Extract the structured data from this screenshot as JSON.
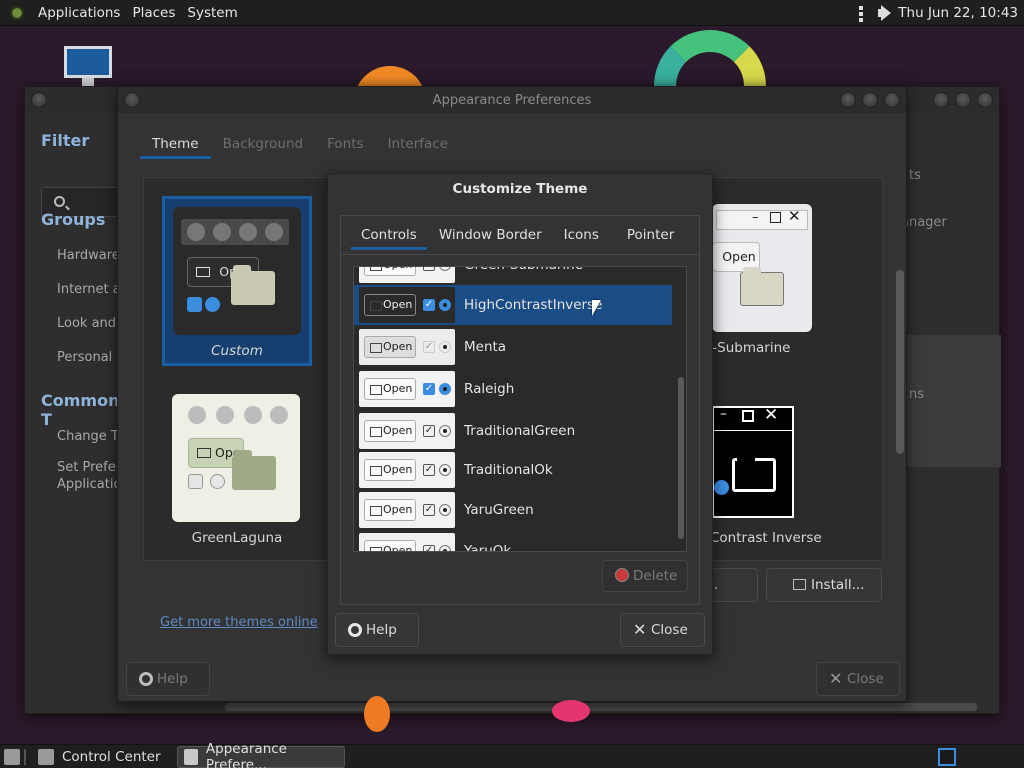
{
  "top_panel": {
    "applications": "Applications",
    "places": "Places",
    "system": "System",
    "clock": "Thu Jun 22, 10:43",
    "tray_icons": [
      "menu-dots-icon",
      "speaker-icon"
    ]
  },
  "control_center": {
    "filter_heading": "Filter",
    "groups_heading": "Groups",
    "groups": [
      "Hardware",
      "Internet a",
      "Look and",
      "Personal"
    ],
    "common_heading": "Common T",
    "common_items": [
      "Change Th",
      "Set Prefer",
      "Applicatio"
    ],
    "right_labels": [
      "ts",
      "anager",
      "ns"
    ]
  },
  "appearance": {
    "title": "Appearance Preferences",
    "tabs": [
      "Theme",
      "Background",
      "Fonts",
      "Interface"
    ],
    "active_tab": "Theme",
    "themes": {
      "custom": "Custom",
      "greenlaguna": "GreenLaguna",
      "submarine": "e-Submarine",
      "hci": "Contrast Inverse"
    },
    "preview_open": "Open",
    "get_more_link": "Get more themes online",
    "customize_button": "mize...",
    "install_button": "Install...",
    "help_button": "Help",
    "close_button": "Close"
  },
  "customize_theme": {
    "title": "Customize Theme",
    "tabs": [
      "Controls",
      "Window Border",
      "Icons",
      "Pointer"
    ],
    "active_tab": "Controls",
    "themes": [
      {
        "name": "Green-Submarine",
        "thumb_label": "Open",
        "selected": false
      },
      {
        "name": "HighContrastInverse",
        "thumb_label": "Open",
        "selected": true
      },
      {
        "name": "Menta",
        "thumb_label": "Open",
        "selected": false
      },
      {
        "name": "Raleigh",
        "thumb_label": "Open",
        "selected": false
      },
      {
        "name": "TraditionalGreen",
        "thumb_label": "Open",
        "selected": false
      },
      {
        "name": "TraditionalOk",
        "thumb_label": "Open",
        "selected": false
      },
      {
        "name": "YaruGreen",
        "thumb_label": "Open",
        "selected": false
      },
      {
        "name": "YaruOk",
        "thumb_label": "Open",
        "selected": false
      }
    ],
    "delete_button": "Delete",
    "help_button": "Help",
    "close_button": "Close"
  },
  "taskbar": {
    "items": [
      "Control Center",
      "Appearance Prefere..."
    ]
  },
  "colors": {
    "accent": "#1b5fa3",
    "selection": "#1a4d86",
    "window_bg": "#333333",
    "link": "#5c8bc2"
  }
}
